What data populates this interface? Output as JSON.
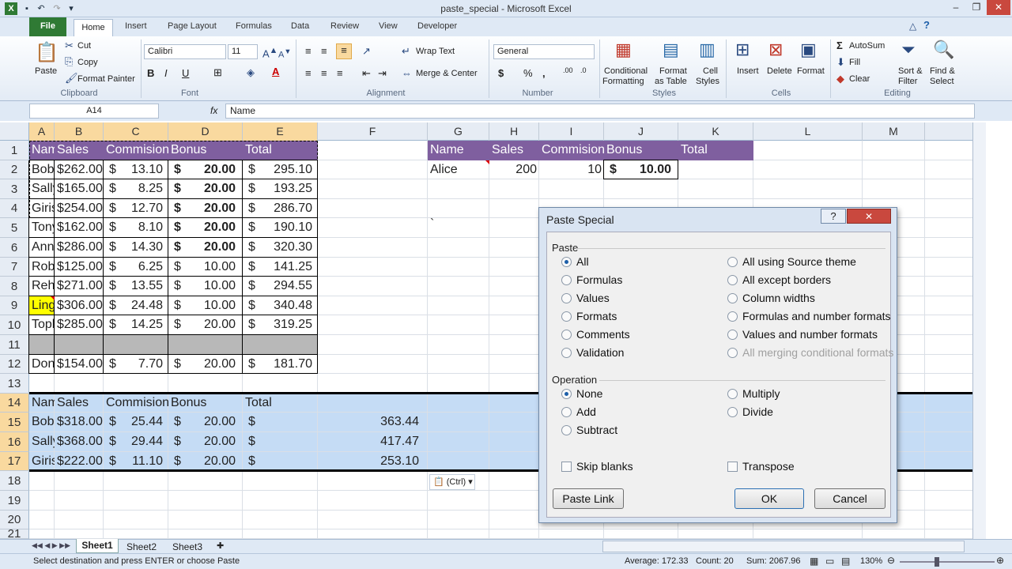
{
  "window": {
    "title": "paste_special - Microsoft Excel"
  },
  "tabs": [
    "File",
    "Home",
    "Insert",
    "Page Layout",
    "Formulas",
    "Data",
    "Review",
    "View",
    "Developer"
  ],
  "ribbon": {
    "clipboard": {
      "paste": "Paste",
      "cut": "Cut",
      "copy": "Copy",
      "format_painter": "Format Painter",
      "label": "Clipboard"
    },
    "font": {
      "name": "Calibri",
      "size": "11",
      "label": "Font"
    },
    "alignment": {
      "wrap": "Wrap Text",
      "merge": "Merge & Center",
      "label": "Alignment"
    },
    "number": {
      "format": "General",
      "label": "Number"
    },
    "styles": {
      "conditional1": "Conditional",
      "conditional2": "Formatting",
      "format1": "Format",
      "format2": "as Table",
      "cell1": "Cell",
      "cell2": "Styles",
      "label": "Styles"
    },
    "cells": {
      "insert": "Insert",
      "delete": "Delete",
      "format": "Format",
      "label": "Cells"
    },
    "editing": {
      "autosum": "AutoSum",
      "fill": "Fill",
      "clear": "Clear",
      "sort1": "Sort &",
      "sort2": "Filter",
      "find1": "Find &",
      "find2": "Select",
      "label": "Editing"
    }
  },
  "formula_bar": {
    "name_box": "A14",
    "fx": "fx",
    "value": "Name"
  },
  "columns": [
    "A",
    "B",
    "C",
    "D",
    "E",
    "F",
    "G",
    "H",
    "I",
    "J",
    "K",
    "L",
    "M"
  ],
  "rows": [
    "1",
    "2",
    "3",
    "4",
    "5",
    "6",
    "7",
    "8",
    "9",
    "10",
    "11",
    "12",
    "13",
    "14",
    "15",
    "16",
    "17",
    "18",
    "19",
    "20",
    "21"
  ],
  "table1": {
    "headers": [
      "Name",
      "Sales",
      "Commision",
      "Bonus",
      "Total"
    ],
    "rows": [
      [
        "Bob",
        "$262.00",
        "$",
        "13.10",
        "$",
        "20.00",
        "$",
        "295.10"
      ],
      [
        "Sally",
        "$165.00",
        "$",
        "8.25",
        "$",
        "20.00",
        "$",
        "193.25"
      ],
      [
        "Girish",
        "$254.00",
        "$",
        "12.70",
        "$",
        "20.00",
        "$",
        "286.70"
      ],
      [
        "Tony",
        "$162.00",
        "$",
        "8.10",
        "$",
        "20.00",
        "$",
        "190.10"
      ],
      [
        "Ann",
        "$286.00",
        "$",
        "14.30",
        "$",
        "20.00",
        "$",
        "320.30"
      ],
      [
        "Robert",
        "$125.00",
        "$",
        "6.25",
        "$",
        "10.00",
        "$",
        "141.25"
      ],
      [
        "Rehka",
        "$271.00",
        "$",
        "13.55",
        "$",
        "10.00",
        "$",
        "294.55"
      ],
      [
        "Ling",
        "$306.00",
        "$",
        "24.48",
        "$",
        "10.00",
        "$",
        "340.48"
      ],
      [
        "Topher",
        "$285.00",
        "$",
        "14.25",
        "$",
        "20.00",
        "$",
        "319.25"
      ],
      [
        "",
        "",
        "",
        "",
        "",
        "",
        "",
        ""
      ],
      [
        "Donald",
        "$154.00",
        "$",
        "7.70",
        "$",
        "20.00",
        "$",
        "181.70"
      ]
    ]
  },
  "table2": {
    "headers": [
      "Name",
      "Sales",
      "Commision",
      "Bonus",
      "Total"
    ],
    "rows": [
      [
        "Bob",
        "$318.00",
        "$",
        "25.44",
        "$",
        "20.00",
        "$",
        "363.44"
      ],
      [
        "Sally",
        "$368.00",
        "$",
        "29.44",
        "$",
        "20.00",
        "$",
        "417.47"
      ],
      [
        "Girish",
        "$222.00",
        "$",
        "11.10",
        "$",
        "20.00",
        "$",
        "253.10"
      ]
    ]
  },
  "table3": {
    "headers": [
      "Name",
      "Sales",
      "Commision",
      "Bonus",
      "Total"
    ],
    "row": [
      "Alice",
      "200",
      "10",
      "$",
      "10.00"
    ]
  },
  "misc": {
    "backtick": "`",
    "ctrl": "(Ctrl)"
  },
  "dialog": {
    "title": "Paste Special",
    "help": "?",
    "close": "✕",
    "paste_label": "Paste",
    "paste_options_left": [
      "All",
      "Formulas",
      "Values",
      "Formats",
      "Comments",
      "Validation"
    ],
    "paste_options_right": [
      "All using Source theme",
      "All except borders",
      "Column widths",
      "Formulas and number formats",
      "Values and number formats",
      "All merging conditional formats"
    ],
    "selected_paste": "All",
    "operation_label": "Operation",
    "operation_left": [
      "None",
      "Add",
      "Subtract"
    ],
    "operation_right": [
      "Multiply",
      "Divide"
    ],
    "selected_operation": "None",
    "skip_blanks": "Skip blanks",
    "transpose": "Transpose",
    "paste_link": "Paste Link",
    "ok": "OK",
    "cancel": "Cancel"
  },
  "sheets": [
    "Sheet1",
    "Sheet2",
    "Sheet3"
  ],
  "status": {
    "message": "Select destination and press ENTER or choose Paste",
    "average": "Average: 172.33",
    "count": "Count: 20",
    "sum": "Sum: 2067.96",
    "zoom": "130%"
  }
}
